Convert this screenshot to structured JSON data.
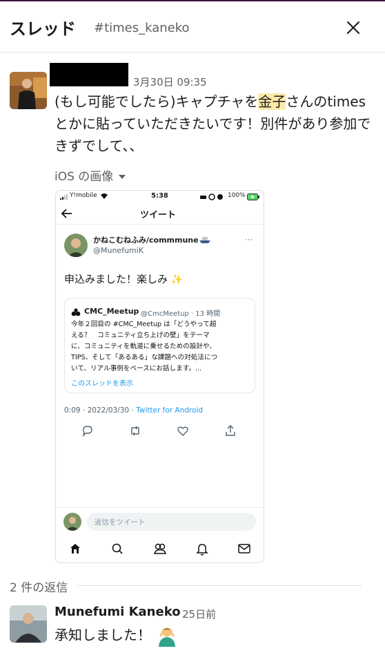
{
  "header": {
    "title": "スレッド",
    "channel": "#times_kaneko"
  },
  "parent": {
    "timestamp": "3月30日 09:35",
    "text_before": "(もし可能でしたら)キャプチャを",
    "highlight": "金子",
    "text_after": "さんのtimesとかに貼っていただきたいです！別件があり参加できずでして、、",
    "attachment_label": "iOS の画像"
  },
  "screenshot": {
    "status_carrier": "Y!mobile",
    "status_time": "5:38",
    "status_battery": "100%",
    "title": "ツイート",
    "user_name": "かねこむねふみ/commmune",
    "user_handle": "@MunefumiK",
    "tweet_text": "申込みました！楽しみ",
    "quote_name": "CMC_Meetup",
    "quote_handle": "@CmcMeetup · 13 時間",
    "quote_lines": [
      "今年２回目の #CMC_Meetup は「どうやって超",
      "える？　コミュニティ立ち上げの壁」をテーマ",
      "に、コミュニティを軌道に乗せるための設計や、",
      "TIPS、そして「あるある」な課題への対処法につ",
      "いて、リアル事例をベースにお話します。..."
    ],
    "show_thread": "このスレッドを表示",
    "meta_time": "0:09 · 2022/03/30 · ",
    "meta_app": "Twitter for Android",
    "reply_placeholder": "返信をツイート"
  },
  "replies": {
    "label": "2 件の返信"
  },
  "reply": {
    "author": "Munefumi Kaneko",
    "time": "25日前",
    "text": "承知しました！"
  },
  "colors": {
    "highlight": "#fdeaa8",
    "twitter_blue": "#1d9bf0",
    "muted": "#616061"
  }
}
